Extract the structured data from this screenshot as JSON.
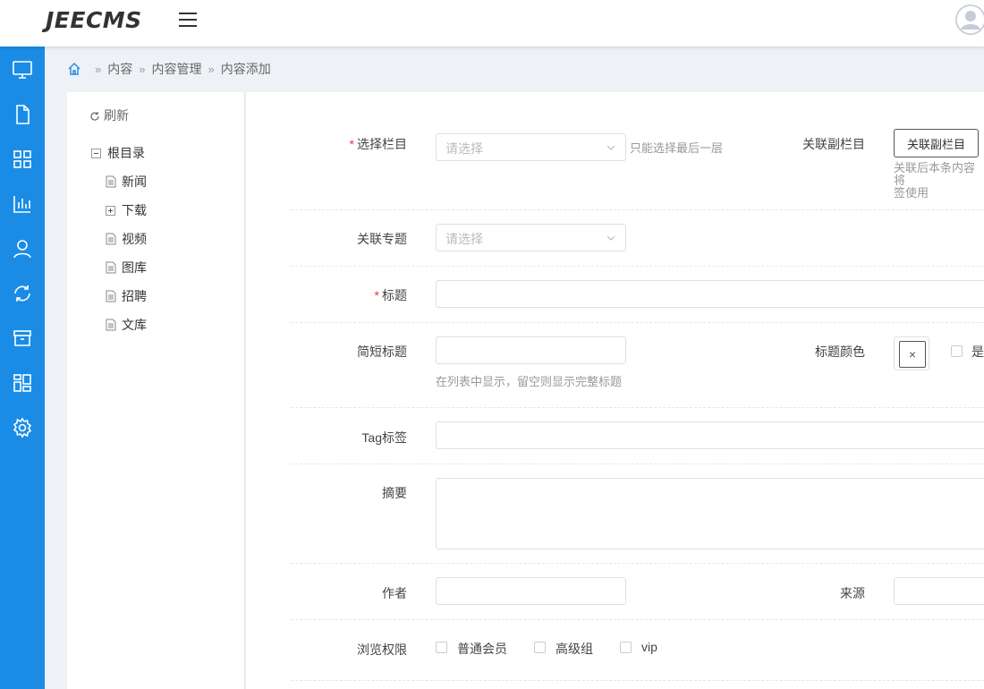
{
  "header": {
    "logo": "JEECMS",
    "menu_icon": "hamburger-icon",
    "avatar_icon": "user-avatar-icon"
  },
  "sidebar": {
    "color": "#1a8ce6",
    "items": [
      {
        "icon": "monitor-icon"
      },
      {
        "icon": "document-icon"
      },
      {
        "icon": "apps-grid-icon"
      },
      {
        "icon": "bar-chart-icon"
      },
      {
        "icon": "user-icon"
      },
      {
        "icon": "sync-icon"
      },
      {
        "icon": "archive-box-icon"
      },
      {
        "icon": "widgets-icon"
      },
      {
        "icon": "settings-icon"
      }
    ]
  },
  "breadcrumb": {
    "items": [
      "内容",
      "内容管理",
      "内容添加"
    ],
    "separator": "»"
  },
  "tree": {
    "refresh_label": "刷新",
    "root_label": "根目录",
    "nodes": [
      {
        "label": "新闻",
        "type": "leaf"
      },
      {
        "label": "下载",
        "type": "folder"
      },
      {
        "label": "视频",
        "type": "leaf"
      },
      {
        "label": "图库",
        "type": "leaf"
      },
      {
        "label": "招聘",
        "type": "leaf"
      },
      {
        "label": "文库",
        "type": "leaf"
      }
    ]
  },
  "form": {
    "channel": {
      "label": "选择栏目",
      "required": "*",
      "placeholder": "请选择",
      "hint": "只能选择最后一层"
    },
    "sub_channel": {
      "label": "关联副栏目",
      "button": "关联副栏目",
      "hint_line1": "关联后本条内容将",
      "hint_line2": "签使用"
    },
    "topic": {
      "label": "关联专题",
      "placeholder": "请选择"
    },
    "title": {
      "label": "标题",
      "required": "*",
      "value": ""
    },
    "short_title": {
      "label": "简短标题",
      "value": "",
      "hint": "在列表中显示，留空则显示完整标题"
    },
    "title_color": {
      "label": "标题颜色",
      "clear_symbol": "×",
      "extra_checkbox_label": "是"
    },
    "tags": {
      "label": "Tag标签",
      "value": ""
    },
    "summary": {
      "label": "摘要",
      "value": ""
    },
    "author": {
      "label": "作者",
      "value": ""
    },
    "source": {
      "label": "来源",
      "value": ""
    },
    "view_permission": {
      "label": "浏览权限",
      "options": [
        "普通会员",
        "高级组",
        "vip"
      ]
    }
  }
}
